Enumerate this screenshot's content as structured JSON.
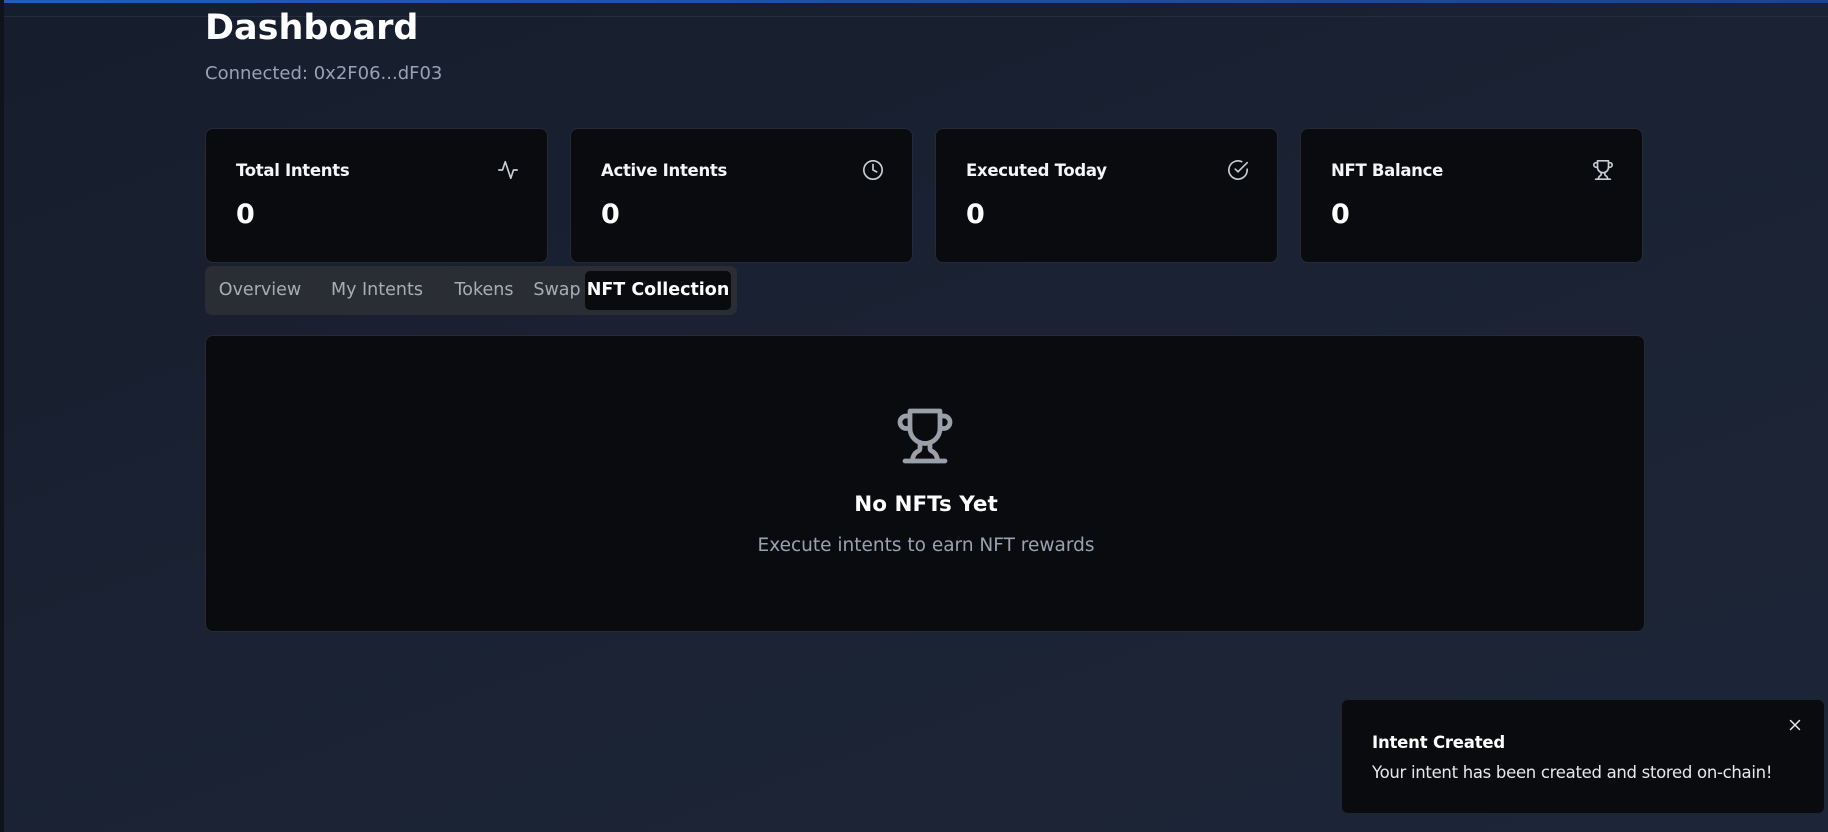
{
  "header": {
    "title": "Dashboard",
    "connected_text": "Connected: 0x2F06...dF03"
  },
  "stats": [
    {
      "label": "Total Intents",
      "value": "0",
      "icon": "activity-icon"
    },
    {
      "label": "Active Intents",
      "value": "0",
      "icon": "clock-icon"
    },
    {
      "label": "Executed Today",
      "value": "0",
      "icon": "check-circle-icon"
    },
    {
      "label": "NFT Balance",
      "value": "0",
      "icon": "trophy-icon"
    }
  ],
  "tabs": [
    {
      "label": "Overview",
      "active": false
    },
    {
      "label": "My Intents",
      "active": false
    },
    {
      "label": "Tokens",
      "active": false
    },
    {
      "label": "Swap",
      "active": false
    },
    {
      "label": "NFT Collection",
      "active": true
    }
  ],
  "empty_state": {
    "icon": "trophy-icon",
    "title": "No NFTs Yet",
    "description": "Execute intents to earn NFT rewards"
  },
  "toast": {
    "title": "Intent Created",
    "description": "Your intent has been created and stored on-chain!",
    "close_icon": "close-icon"
  },
  "colors": {
    "background": "#1a2233",
    "card": "#0a0b0f",
    "muted_text": "#98a2b3",
    "accent_bar": "#1f5fb8",
    "tab_bar": "#2a2d33"
  }
}
